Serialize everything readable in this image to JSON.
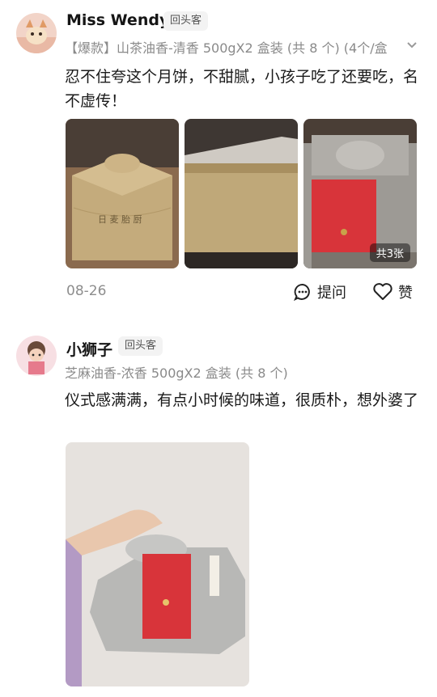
{
  "reviews": [
    {
      "username": "Miss Wendy",
      "badge": "回头客",
      "sku": "【爆款】山茶油香-清香 500gX2 盒装 (共 8 个) (4个/盒",
      "text": "忍不住夸这个月饼，不甜腻，小孩子吃了还要吃，名不虚传！",
      "photo_count_tag": "共3张",
      "date": "08-26",
      "actions": {
        "ask": "提问",
        "like": "赞"
      }
    },
    {
      "username": "小狮子",
      "badge": "回头客",
      "sku": "芝麻油香-浓香 500gX2 盒装 (共 8 个)",
      "text": "仪式感满满，有点小时候的味道，很质朴，想外婆了"
    }
  ],
  "colors": {
    "accent_red": "#d8343a",
    "wrap_gray": "#b8b8b6",
    "kraft": "#bda77a"
  },
  "icons": [
    "sku-chevron-icon",
    "question-bubble-icon",
    "heart-outline-icon"
  ]
}
